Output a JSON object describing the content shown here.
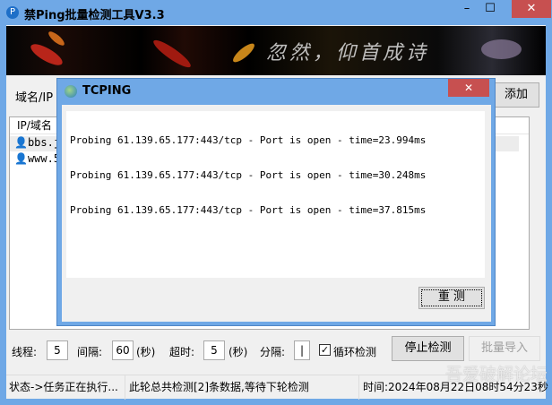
{
  "window": {
    "title": "禁Ping批量检测工具V3.3",
    "icon": "P"
  },
  "banner": {
    "text": "忽然，仰首成诗"
  },
  "domain_row": {
    "label": "域名/IP",
    "add_button": "添加"
  },
  "list": {
    "header": "IP/域名",
    "items": [
      {
        "text": "bbs.j"
      },
      {
        "text": "www.5"
      }
    ]
  },
  "dialog": {
    "title": "TCPING",
    "lines": [
      "Probing 61.139.65.177:443/tcp - Port is open - time=23.994ms",
      "Probing 61.139.65.177:443/tcp - Port is open - time=30.248ms",
      "Probing 61.139.65.177:443/tcp - Port is open - time=37.815ms"
    ],
    "retest_button": "重 测"
  },
  "controls": {
    "threads_label": "线程:",
    "threads": "5",
    "interval_label": "间隔:",
    "interval": "60",
    "sec1": "(秒)",
    "timeout_label": "超时:",
    "timeout": "5",
    "sec2": "(秒)",
    "sep_label": "分隔:",
    "sep": "|",
    "loop_label": "循环检测",
    "loop_checked": true,
    "stop_button": "停止检测",
    "import_button": "批量导入"
  },
  "status": {
    "state": "状态->任务正在执行...",
    "info": "此轮总共检测[2]条数据,等待下轮检测",
    "time": "时间:2024年08月22日08时54分23秒"
  },
  "watermark": "吾爱破解论坛"
}
